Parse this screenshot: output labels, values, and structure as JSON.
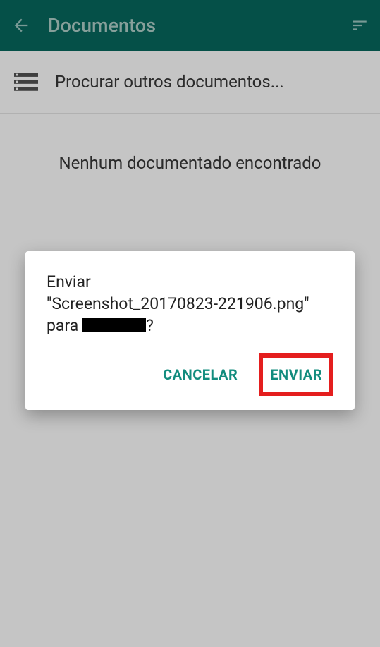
{
  "appBar": {
    "title": "Documentos"
  },
  "searchRow": {
    "label": "Procurar outros documentos..."
  },
  "emptyState": {
    "message": "Nenhum documentado encontrado"
  },
  "dialog": {
    "line1": "Enviar",
    "line2": "\"Screenshot_20170823-221906.png\"",
    "line3a": "para ",
    "line3b": "?",
    "cancelLabel": "CANCELAR",
    "sendLabel": "ENVIAR"
  }
}
